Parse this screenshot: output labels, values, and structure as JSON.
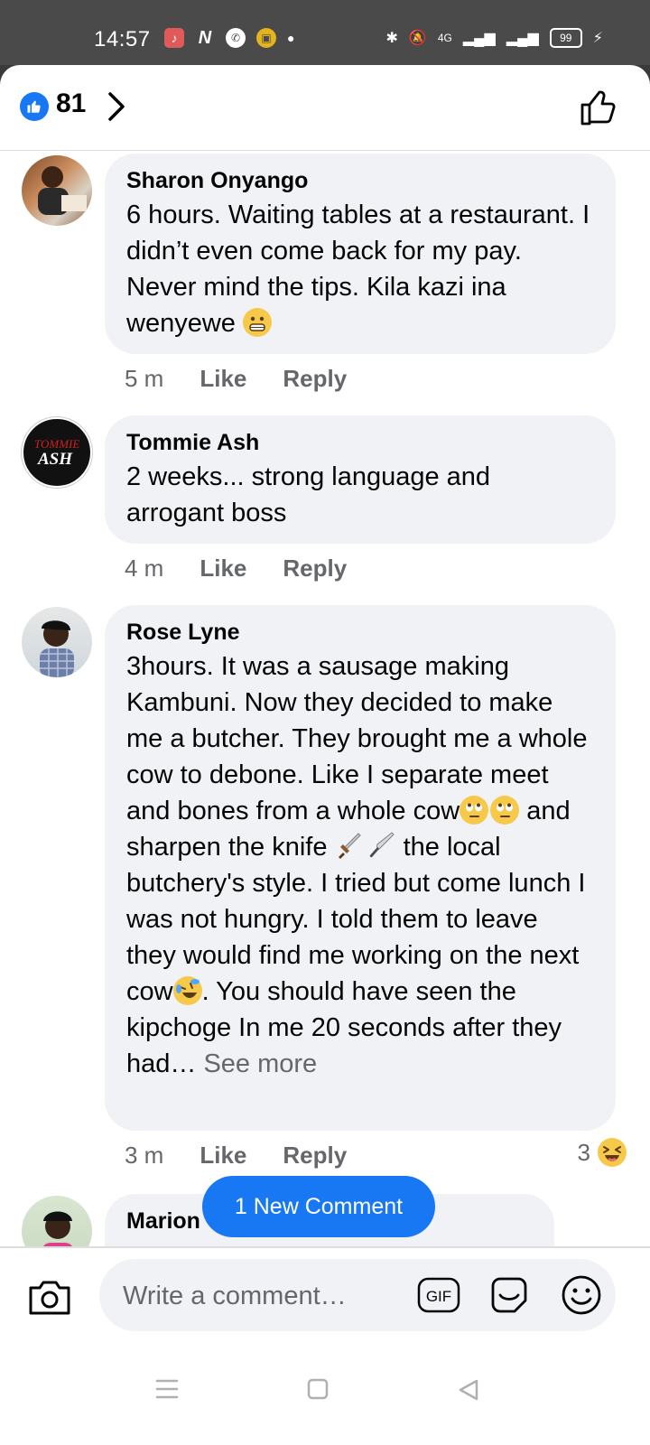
{
  "status_bar": {
    "time": "14:57",
    "network": "4G",
    "battery": "99"
  },
  "header": {
    "reaction_count": "81"
  },
  "comments": [
    {
      "author": "Sharon Onyango",
      "text": "6 hours. Waiting tables at a restaurant. I didn’t even come back for my pay. Never mind the tips. Kila kazi ina wenyewe",
      "time": "5 m",
      "like_label": "Like",
      "reply_label": "Reply"
    },
    {
      "author": "Tommie Ash",
      "avatar_text": "TOMMIE ASH",
      "text": "2 weeks... strong language and arrogant boss",
      "time": "4 m",
      "like_label": "Like",
      "reply_label": "Reply"
    },
    {
      "author": "Rose Lyne",
      "text_part1": "3hours. It was a sausage making Kambuni. Now they decided to make me a butcher. They brought me a whole cow to debone. Like I separate meet and bones from a whole cow",
      "text_part2": " and sharpen the knife ",
      "text_part3": " the local butchery's style. I tried but come lunch I was not hungry. I told them to leave they would find me working on the next cow",
      "text_part4": ". You should have seen the kipchoge In me 20 seconds after they had…",
      "see_more": "See more",
      "time": "3 m",
      "like_label": "Like",
      "reply_label": "Reply",
      "reaction_count": "3"
    },
    {
      "author": "Marion"
    }
  ],
  "new_comment_button": "1 New Comment",
  "composer": {
    "placeholder": "Write a comment…",
    "gif_label": "GIF"
  },
  "colors": {
    "accent": "#1877f2",
    "bubble": "#f0f2f5",
    "secondary_text": "#65676b"
  }
}
